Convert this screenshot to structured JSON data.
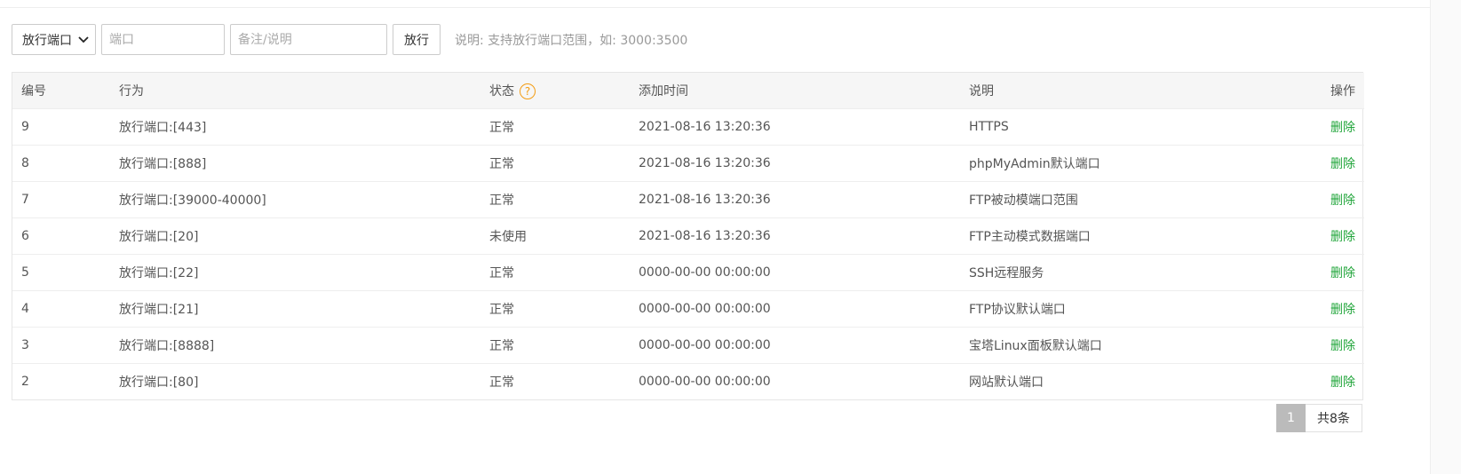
{
  "toolbar": {
    "type_select": {
      "selected": "放行端口"
    },
    "port_input": {
      "placeholder": "端口"
    },
    "note_input": {
      "placeholder": "备注/说明"
    },
    "submit_label": "放行",
    "hint": "说明: 支持放行端口范围，如: 3000:3500"
  },
  "table": {
    "headers": {
      "id": "编号",
      "action": "行为",
      "status": "状态",
      "time": "添加时间",
      "note": "说明",
      "op": "操作"
    },
    "rows": [
      {
        "id": "9",
        "action": "放行端口:[443]",
        "status": "正常",
        "time": "2021-08-16 13:20:36",
        "note": "HTTPS",
        "op": "删除"
      },
      {
        "id": "8",
        "action": "放行端口:[888]",
        "status": "正常",
        "time": "2021-08-16 13:20:36",
        "note": "phpMyAdmin默认端口",
        "op": "删除"
      },
      {
        "id": "7",
        "action": "放行端口:[39000-40000]",
        "status": "正常",
        "time": "2021-08-16 13:20:36",
        "note": "FTP被动模端口范围",
        "op": "删除"
      },
      {
        "id": "6",
        "action": "放行端口:[20]",
        "status": "未使用",
        "time": "2021-08-16 13:20:36",
        "note": "FTP主动模式数据端口",
        "op": "删除"
      },
      {
        "id": "5",
        "action": "放行端口:[22]",
        "status": "正常",
        "time": "0000-00-00 00:00:00",
        "note": "SSH远程服务",
        "op": "删除"
      },
      {
        "id": "4",
        "action": "放行端口:[21]",
        "status": "正常",
        "time": "0000-00-00 00:00:00",
        "note": "FTP协议默认端口",
        "op": "删除"
      },
      {
        "id": "3",
        "action": "放行端口:[8888]",
        "status": "正常",
        "time": "0000-00-00 00:00:00",
        "note": "宝塔Linux面板默认端口",
        "op": "删除"
      },
      {
        "id": "2",
        "action": "放行端口:[80]",
        "status": "正常",
        "time": "0000-00-00 00:00:00",
        "note": "网站默认端口",
        "op": "删除"
      }
    ]
  },
  "pager": {
    "current": "1",
    "total": "共8条"
  },
  "icons": {
    "status_help": "question-circle-icon",
    "select_chevron": "chevron-down-icon"
  },
  "colors": {
    "delete_link": "#20a53a",
    "help_icon": "#f39c12",
    "active_page": "#bbbbbb"
  }
}
